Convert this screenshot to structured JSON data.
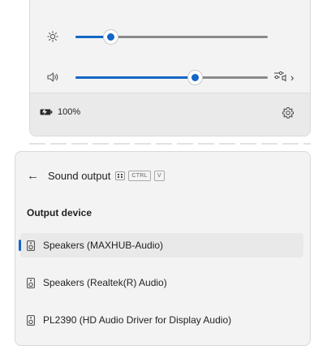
{
  "quick_settings": {
    "brightness": {
      "icon": "sun-icon",
      "level": 0.18
    },
    "volume": {
      "icon": "speaker-icon",
      "level": 0.62,
      "mixer_icon": "audio-mixer-icon",
      "chevron": "›"
    },
    "battery": {
      "icon": "battery-icon",
      "percent_label": "100%"
    },
    "settings_icon": "gear-icon"
  },
  "sound_output": {
    "back_arrow": "←",
    "title": "Sound output",
    "shortcut": {
      "win_icon": "windows-key-icon",
      "keys": [
        "CTRL",
        "V"
      ]
    },
    "section_label": "Output device",
    "devices": [
      {
        "label": "Speakers (MAXHUB-Audio)",
        "selected": true
      },
      {
        "label": "Speakers (Realtek(R) Audio)",
        "selected": false
      },
      {
        "label": "PL2390 (HD Audio Driver for Display Audio)",
        "selected": false
      }
    ]
  },
  "colors": {
    "accent": "#1366c6",
    "panel_bg": "#f3f3f3"
  }
}
